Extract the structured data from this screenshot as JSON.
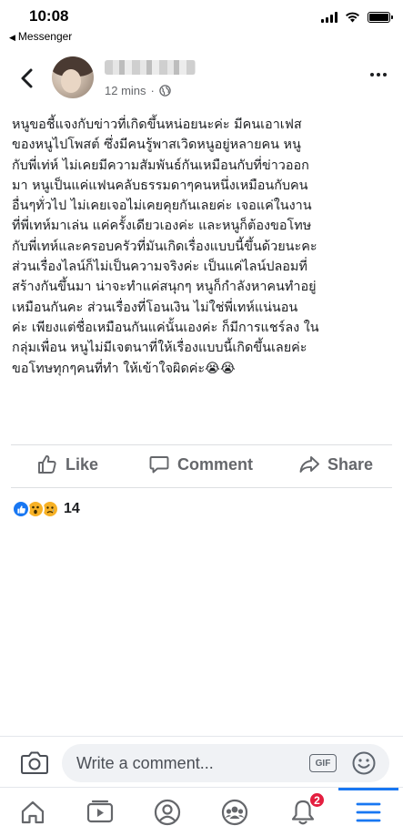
{
  "status_bar": {
    "time": "10:08",
    "back_app": "Messenger"
  },
  "post": {
    "timestamp": "12 mins",
    "separator": "·",
    "body_lines": [
      "หนูขอชี้แจงกับข่าวที่เกิดขึ้นหน่อยนะค่ะ มีคนเอาเฟส",
      "ของหนูไปโพสต์ ซึ่งมีคนรู้พาสเวิดหนูอยู่หลายคน หนู",
      "กับพี่เท่ห์ ไม่เคยมีความสัมพันธ์กันเหมือนกับที่ข่าวออก",
      "มา หนูเป็นแค่แฟนคลับธรรมดาๆคนหนึ่งเหมือนกับคน",
      "อื่นๆทั่วไป ไม่เคยเจอไม่เคยคุยกันเลยค่ะ เจอแค่ในงาน",
      "ที่พี่เทห์มาเล่น แค่ครั้งเดียวเองค่ะ และหนูก็ต้องขอโทษ",
      "กับพี่เทห์และครอบครัวที่มันเกิดเรื่องแบบนี้ขึ้นด้วยนะคะ",
      "ส่วนเรื่องไลน์ก็ไม่เป็นความจริงค่ะ เป็นแค่ไลน์ปลอมที่",
      "สร้างกันขึ้นมา น่าจะทำแค่สนุกๆ หนูก็กำลังหาคนทำอยู่",
      "เหมือนกันคะ ส่วนเรื่องที่โอนเงิน ไม่ใช่พี่เทห์แน่นอน",
      "ค่ะ เพียงแต่ชื่อเหมือนกันแค่นั้นเองค่ะ ก็มีการแชร์ลง ใน",
      "กลุ่มเพื่อน หนูไม่มีเจตนาที่ให้เรื่องแบบนี้เกิดขึ้นเลยค่ะ",
      "ขอโทษทุกๆคนที่ทำ ให้เข้าใจผิดค่ะ😭😭"
    ]
  },
  "actions": {
    "like": "Like",
    "comment": "Comment",
    "share": "Share"
  },
  "reactions": {
    "count": "14",
    "types": [
      "like-icon",
      "wow-icon",
      "sad-icon"
    ]
  },
  "composer": {
    "placeholder": "Write a comment...",
    "gif_label": "GIF"
  },
  "tabbar": {
    "items": [
      "home-icon",
      "watch-icon",
      "profile-icon",
      "groups-icon",
      "notifications-icon",
      "menu-icon"
    ],
    "notifications_badge": "2",
    "active": "menu-icon"
  },
  "colors": {
    "accent": "#1877f2",
    "badge": "#e41e3f",
    "secondary_text": "#65676b",
    "input_bg": "#f0f2f5"
  }
}
